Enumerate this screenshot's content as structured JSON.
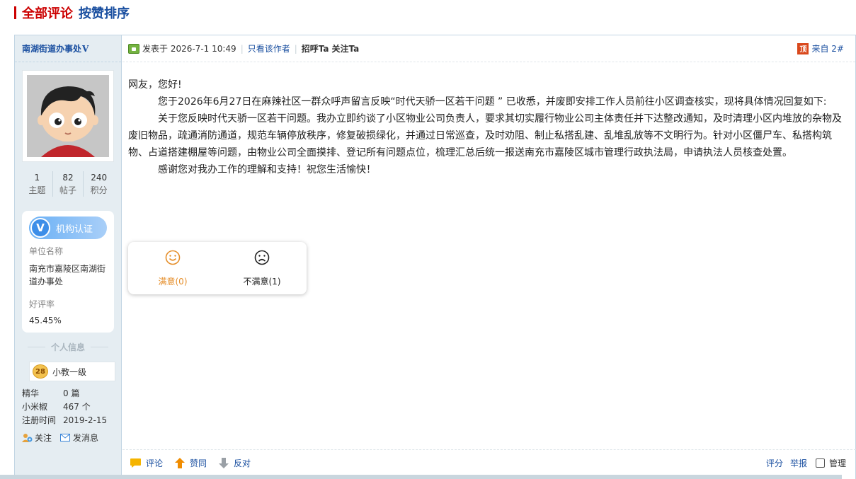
{
  "header": {
    "title_all": "全部评论",
    "title_sort": "按赞排序"
  },
  "sidebar": {
    "author_name": "南湖街道办事处",
    "author_v": "V",
    "stats": [
      {
        "num": "1",
        "label": "主题"
      },
      {
        "num": "82",
        "label": "帖子"
      },
      {
        "num": "240",
        "label": "积分"
      }
    ],
    "verify_label": "机构认证",
    "verify_v": "V",
    "unit_label": "单位名称",
    "unit_value": "南充市嘉陵区南湖街道办事处",
    "rating_label": "好评率",
    "rating_value": "45.45%",
    "personal_info": "个人信息",
    "level_num": "28",
    "level_text": "小教一级",
    "meta": [
      {
        "k": "精华",
        "v": "0 篇"
      },
      {
        "k": "小米椒",
        "v": "467 个"
      },
      {
        "k": "注册时间",
        "v": "2019-2-15"
      }
    ],
    "follow_label": "关注",
    "message_label": "发消息"
  },
  "post": {
    "posted_prefix": "发表于 2026-7-1 10:49",
    "only_author": "只看该作者",
    "greet_ta": "招呼Ta",
    "follow_ta": "关注Ta",
    "top_badge": "顶",
    "floor": "来自 2#",
    "greeting": "网友，您好!",
    "paragraphs": [
      "您于2026年6月27日在麻辣社区一群众呼声留言反映“时代天骄一区若干问题 ” 已收悉，并废即安排工作人员前往小区调查核实，现将具体情况回复如下:",
      "关于您反映时代天骄一区若干问题。我办立即约谈了小区物业公司负责人，要求其切实履行物业公司主体责任并下达整改通知，及时清理小区内堆放的杂物及废旧物品，疏通消防通道，规范车辆停放秩序，修复破损绿化，并通过日常巡查，及时劝阻、制止私搭乱建、乱堆乱放等不文明行为。针对小区僵尸车、私搭构筑物、占道搭建棚屋等问题，由物业公司全面摸排、登记所有问题点位，梳理汇总后统一报送南充市嘉陵区城市管理行政执法局，申请执法人员核查处置。",
      "感谢您对我办工作的理解和支持！祝您生活愉快！"
    ],
    "satisfied": "满意(0)",
    "unsatisfied": "不满意(1)"
  },
  "footer": {
    "comment": "评论",
    "upvote": "赞同",
    "oppose": "反对",
    "rate": "评分",
    "report": "举报",
    "manage": "管理"
  }
}
